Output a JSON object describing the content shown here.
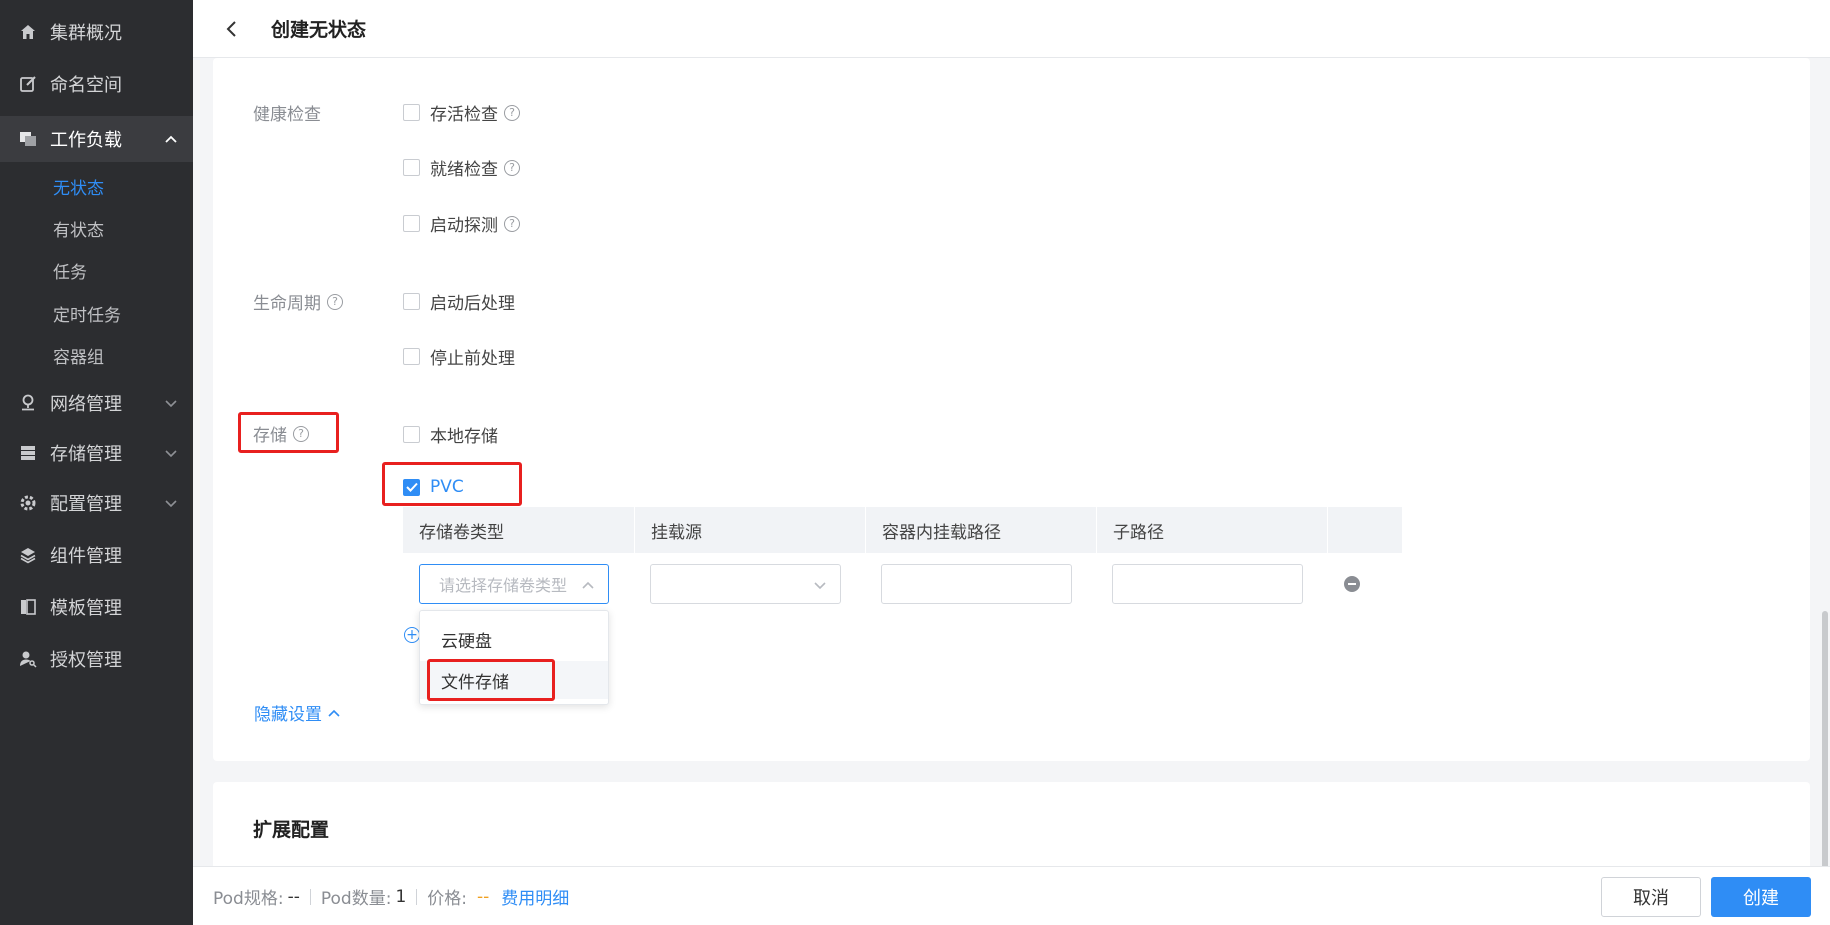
{
  "sidebar": {
    "items": [
      {
        "label": "集群概况",
        "icon": "home-icon"
      },
      {
        "label": "命名空间",
        "icon": "edit-icon"
      },
      {
        "label": "工作负载",
        "icon": "layers-icon",
        "expanded": true
      },
      {
        "label": "网络管理",
        "icon": "network-icon"
      },
      {
        "label": "存储管理",
        "icon": "storage-icon"
      },
      {
        "label": "配置管理",
        "icon": "gear-icon"
      },
      {
        "label": "组件管理",
        "icon": "stack-icon"
      },
      {
        "label": "模板管理",
        "icon": "template-icon"
      },
      {
        "label": "授权管理",
        "icon": "user-key-icon"
      }
    ],
    "subitems": [
      "无状态",
      "有状态",
      "任务",
      "定时任务",
      "容器组"
    ],
    "active_subitem": "无状态"
  },
  "header": {
    "title": "创建无状态"
  },
  "form": {
    "health_label": "健康检查",
    "health_options": [
      "存活检查",
      "就绪检查",
      "启动探测"
    ],
    "lifecycle_label": "生命周期",
    "lifecycle_options": [
      "启动后处理",
      "停止前处理"
    ],
    "storage_label": "存储",
    "storage_options": [
      "本地存储",
      "PVC"
    ],
    "storage_checked": "PVC",
    "table_headers": [
      "存储卷类型",
      "挂载源",
      "容器内挂载路径",
      "子路径"
    ],
    "volume_type_placeholder": "请选择存储卷类型",
    "dropdown_options": [
      "云硬盘",
      "文件存储"
    ],
    "hide_settings": "隐藏设置"
  },
  "extension": {
    "title": "扩展配置"
  },
  "footer": {
    "pod_spec_label": "Pod规格:",
    "pod_spec_value": "--",
    "pod_count_label": "Pod数量:",
    "pod_count_value": "1",
    "price_label": "价格:",
    "price_value": "--",
    "fee_detail": "费用明细",
    "cancel": "取消",
    "create": "创建"
  },
  "colors": {
    "accent": "#2f8df5",
    "sidebar_bg": "#2c2d30",
    "highlight": "#e8201f",
    "price": "#f0a020"
  }
}
